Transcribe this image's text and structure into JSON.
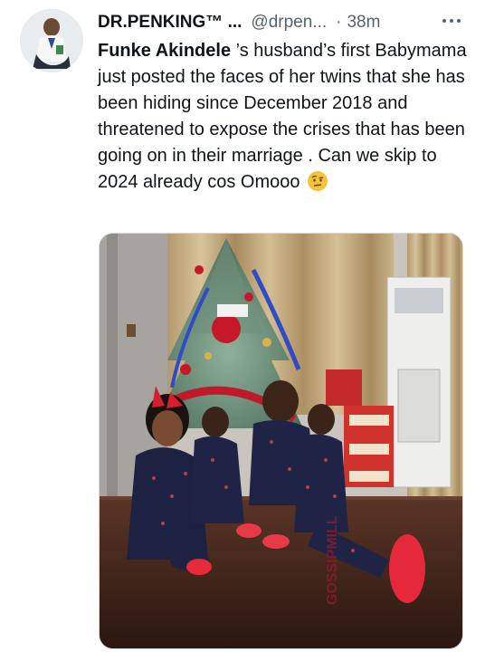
{
  "tweet": {
    "author": {
      "display_name": "DR.PENKING™ ...",
      "handle": "@drpen...",
      "separator": "·",
      "time": "38m"
    },
    "more_icon": "more-horizontal-icon",
    "text": {
      "mention": "Funke Akindele",
      "body": " ’s husband’s first Babymama just posted the faces of her twins that she has been hiding since December 2018 and threatened to expose the crises that has been going on in their marriage . Can we skip to 2024 already cos Omooo",
      "emoji": "face-with-raised-eyebrow-emoji"
    },
    "media": {
      "watermark": "GOSSIPMILL"
    }
  },
  "colors": {
    "text_primary": "#0f1419",
    "text_secondary": "#536471",
    "border": "#cfd9de"
  }
}
